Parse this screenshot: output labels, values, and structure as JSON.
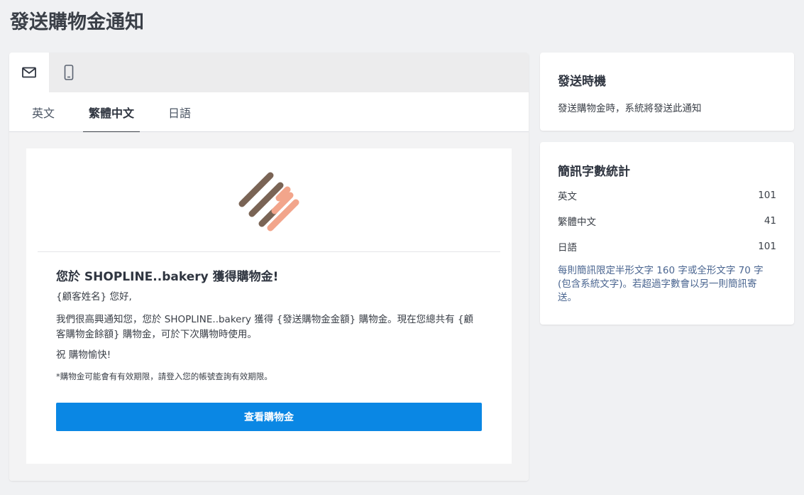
{
  "page": {
    "title": "發送購物金通知"
  },
  "channels": [
    {
      "icon": "envelope-icon",
      "active": true
    },
    {
      "icon": "mobile-phone-icon",
      "active": false
    }
  ],
  "language_tabs": [
    {
      "label": "英文"
    },
    {
      "label": "繁體中文",
      "active": true
    },
    {
      "label": "日語"
    }
  ],
  "email_preview": {
    "heading": "您於 SHOPLINE..bakery 獲得購物金!",
    "greeting": "{顧客姓名} 您好,",
    "body": "我們很高興通知您，您於 SHOPLINE..bakery 獲得 {發送購物金金額} 購物金。現在您總共有 {顧客購物金餘額} 購物金，可於下次購物時使用。",
    "wish": "祝 購物愉快!",
    "note": "*購物金可能會有有效期限，請登入您的帳號查詢有效期限。",
    "button_label": "查看購物金",
    "colors": {
      "button": "#0a87e4",
      "logo_brown": "#7a6455",
      "logo_salmon": "#f2a58b"
    }
  },
  "timing_card": {
    "title": "發送時機",
    "text": "發送購物金時，系統將發送此通知"
  },
  "sms_stats": {
    "title": "簡訊字數統計",
    "rows": [
      {
        "label": "英文",
        "value": "101"
      },
      {
        "label": "繁體中文",
        "value": "41"
      },
      {
        "label": "日語",
        "value": "101"
      }
    ],
    "note": "每則簡訊限定半形文字 160 字或全形文字 70 字 (包含系統文字)。若超過字數會以另一則簡訊寄送。"
  }
}
